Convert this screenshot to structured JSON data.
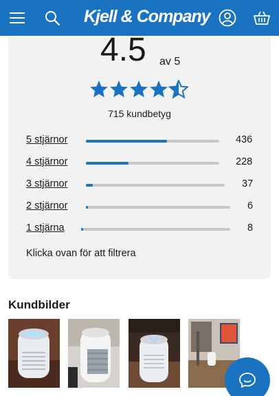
{
  "header": {
    "logo_text": "Kjell & Company",
    "menu_icon": "hamburger-menu-icon",
    "search_icon": "search-icon",
    "account_icon": "user-account-icon",
    "cart_icon": "shopping-basket-icon",
    "background_color": "#1a73c1"
  },
  "rating": {
    "score": "4.5",
    "out_of": "av 5",
    "stars_value": 4.5,
    "star_color": "#1a73c1",
    "count_label": "715 kundbetyg",
    "rows": [
      {
        "label": "5 stjärnor",
        "count": "436",
        "fraction": 0.61
      },
      {
        "label": "4 stjärnor",
        "count": "228",
        "fraction": 0.32
      },
      {
        "label": "3 stjärnor",
        "count": "37",
        "fraction": 0.05
      },
      {
        "label": "2 stjärnor",
        "count": "6",
        "fraction": 0.01
      },
      {
        "label": "1 stjärna",
        "count": "8",
        "fraction": 0.01
      }
    ],
    "hint": "Klicka ovan för att filtrera"
  },
  "customer_images": {
    "title": "Kundbilder",
    "images": [
      {
        "name": "customer-photo-1"
      },
      {
        "name": "customer-photo-2"
      },
      {
        "name": "customer-photo-3"
      },
      {
        "name": "customer-photo-4"
      }
    ]
  },
  "chat": {
    "icon": "chat-bubble-icon"
  }
}
